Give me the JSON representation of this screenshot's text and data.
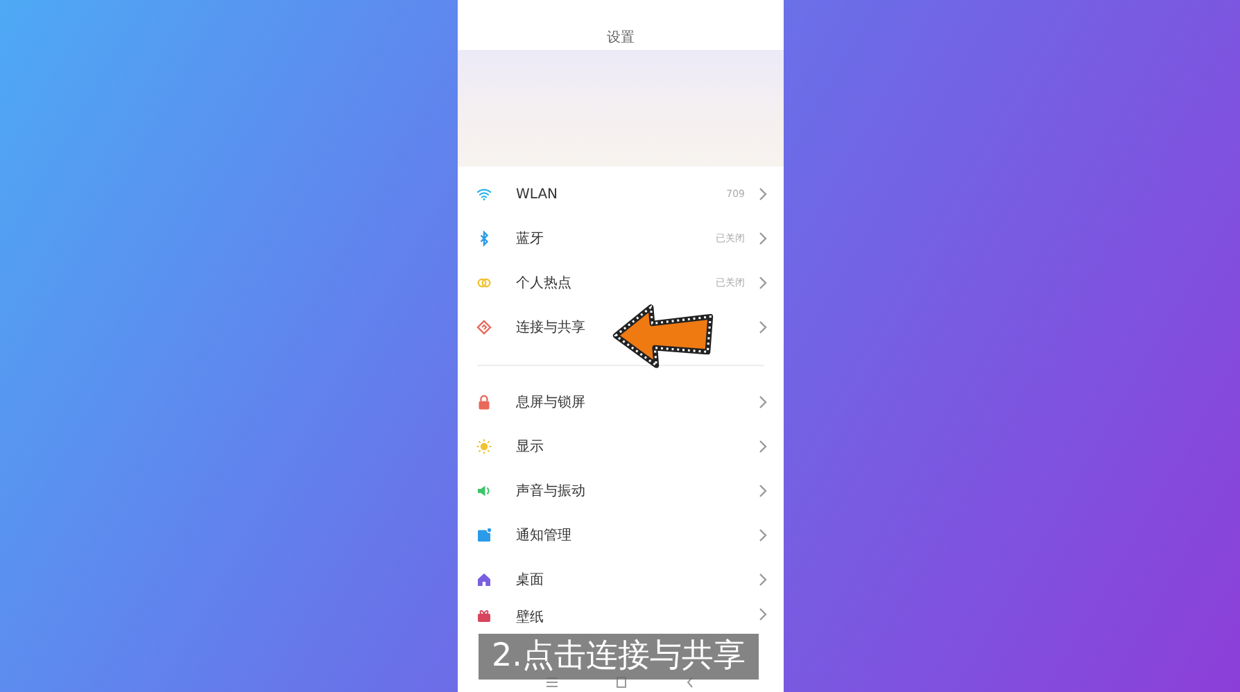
{
  "screen": {
    "title": "设置"
  },
  "sections": [
    {
      "items": [
        {
          "label": "WLAN",
          "value": "709"
        },
        {
          "label": "蓝牙",
          "value": "已关闭"
        },
        {
          "label": "个人热点",
          "value": "已关闭"
        },
        {
          "label": "连接与共享"
        }
      ]
    },
    {
      "items": [
        {
          "label": "息屏与锁屏"
        },
        {
          "label": "显示"
        },
        {
          "label": "声音与振动"
        },
        {
          "label": "通知管理"
        },
        {
          "label": "桌面"
        },
        {
          "label": "壁纸"
        }
      ]
    }
  ],
  "caption": "2.点击连接与共享"
}
